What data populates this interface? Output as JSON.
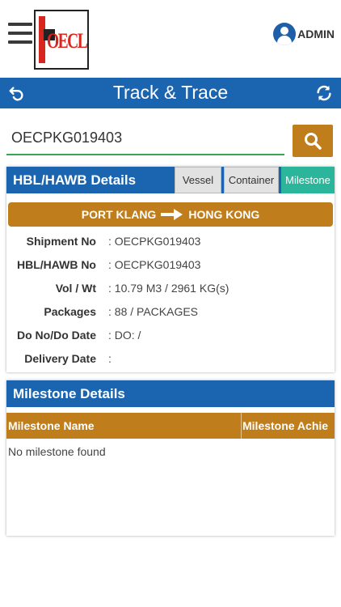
{
  "header": {
    "logo_text": "OECL",
    "user_label": "ADMIN"
  },
  "titlebar": {
    "title": "Track & Trace"
  },
  "search": {
    "value": "OECPKG019403"
  },
  "details": {
    "heading": "HBL/HAWB Details",
    "tabs": [
      "Vessel",
      "Container",
      "Milestone"
    ],
    "route_from": "PORT KLANG",
    "route_to": "HONG KONG",
    "rows": [
      {
        "label": "Shipment No",
        "value": ": OECPKG019403"
      },
      {
        "label": "HBL/HAWB No",
        "value": ": OECPKG019403"
      },
      {
        "label": "Vol / Wt",
        "value": ": 10.79 M3 / 2961 KG(s)"
      },
      {
        "label": "Packages",
        "value": ": 88 / PACKAGES"
      },
      {
        "label": "Do No/Do Date",
        "value": ": DO: /"
      },
      {
        "label": "Delivery Date",
        "value": ":"
      }
    ]
  },
  "milestones": {
    "heading": "Milestone Details",
    "columns": [
      "Milestone Name",
      "Milestone Achie"
    ],
    "empty_message": "No milestone found"
  },
  "colors": {
    "primary_blue": "#1a64b0",
    "accent_brown": "#c07d1b",
    "active_tab_teal": "#2bb59a",
    "input_underline_green": "#3aa655",
    "logo_red": "#d7261e"
  }
}
